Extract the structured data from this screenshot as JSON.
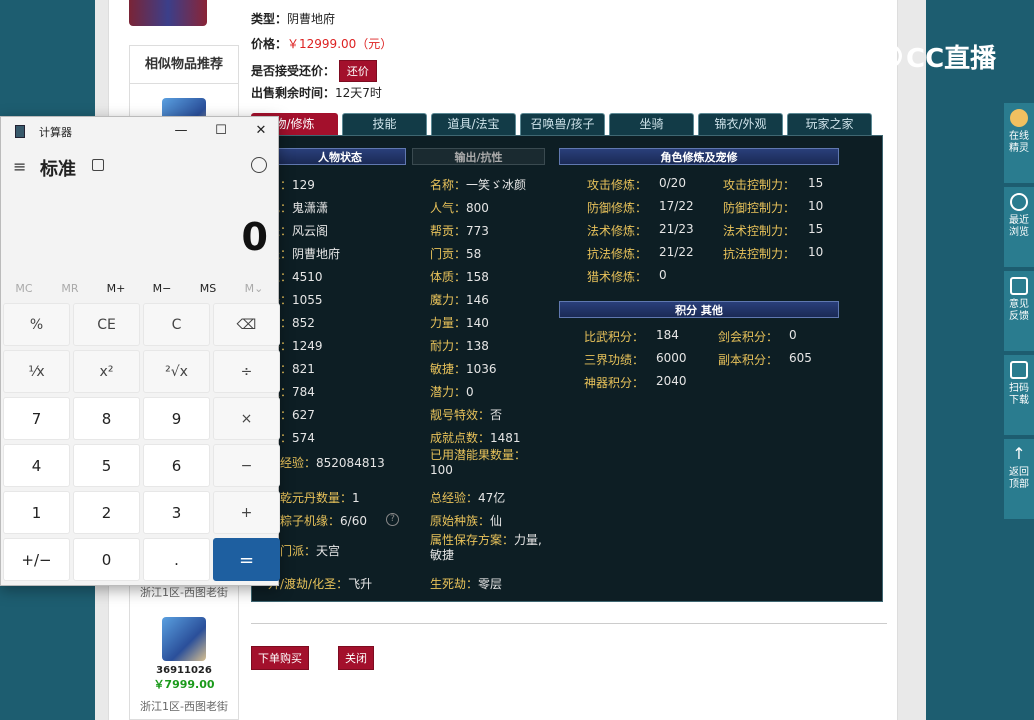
{
  "listing": {
    "type_label": "类型：",
    "type_value": "阴曹地府",
    "price_label": "价格：",
    "price_value": "￥12999.00（元）",
    "counter_offer_label": "是否接受还价：",
    "counter_offer_button": "还价",
    "remaining_label": "出售剩余时间：",
    "remaining_value": "12天7时",
    "buy_button": "下单购买",
    "close_button": "关闭"
  },
  "similar": {
    "title": "相似物品推荐",
    "server_top": "浙江1区-西图老街",
    "item_id": "36911026",
    "item_price": "￥7999.00",
    "server_bottom": "浙江1区-西图老街"
  },
  "tabs": [
    "物/修炼",
    "技能",
    "道具/法宝",
    "召唤兽/孩子",
    "坐骑",
    "锦衣/外观",
    "玩家之家"
  ],
  "panel": {
    "hdr_status": "人物状态",
    "hdr_output": "输出/抗性",
    "hdr_cultivation": "角色修炼及宠修",
    "hdr_points": "积分 其他",
    "col1": [
      {
        "k": "别：",
        "v": "129"
      },
      {
        "k": "色：",
        "v": "鬼潇潇"
      },
      {
        "k": "派：",
        "v": "风云阁"
      },
      {
        "k": "派：",
        "v": "阴曹地府"
      },
      {
        "k": "血：",
        "v": "4510"
      },
      {
        "k": "法：",
        "v": "1055"
      },
      {
        "k": "中：",
        "v": "852"
      },
      {
        "k": "害：",
        "v": "1249"
      },
      {
        "k": "御：",
        "v": "821"
      },
      {
        "k": "度：",
        "v": "784"
      },
      {
        "k": "伤：",
        "v": "627"
      },
      {
        "k": "防：",
        "v": "574"
      },
      {
        "k": "得经验：",
        "v": "852084813"
      },
      {
        "k": "版乾元丹数量：",
        "v": "1"
      },
      {
        "k": "饼粽子机缘：",
        "v": "6/60"
      },
      {
        "k": "史门派：",
        "v": "天宫"
      },
      {
        "k": "升/渡劫/化圣：",
        "v": "飞升"
      }
    ],
    "col2": [
      {
        "k": "名称：",
        "v": "一笑ゞ冰颜"
      },
      {
        "k": "人气：",
        "v": "800"
      },
      {
        "k": "帮贡：",
        "v": "773"
      },
      {
        "k": "门贡：",
        "v": "58"
      },
      {
        "k": "体质：",
        "v": "158"
      },
      {
        "k": "魔力：",
        "v": "146"
      },
      {
        "k": "力量：",
        "v": "140"
      },
      {
        "k": "耐力：",
        "v": "138"
      },
      {
        "k": "敏捷：",
        "v": "1036"
      },
      {
        "k": "潜力：",
        "v": "0"
      },
      {
        "k": "靓号特效：",
        "v": "否"
      },
      {
        "k": "成就点数：",
        "v": "1481"
      },
      {
        "k": "已用潜能果数量：",
        "v": "100"
      },
      {
        "k": "总经验：",
        "v": "47亿"
      },
      {
        "k": "原始种族：",
        "v": "仙"
      },
      {
        "k": "属性保存方案：",
        "v": "力量,敏捷"
      },
      {
        "k": "生死劫：",
        "v": "零层"
      }
    ],
    "cultivation": [
      {
        "k": "攻击修炼：",
        "v": "0/20",
        "k2": "攻击控制力：",
        "v2": "15"
      },
      {
        "k": "防御修炼：",
        "v": "17/22",
        "k2": "防御控制力：",
        "v2": "10"
      },
      {
        "k": "法术修炼：",
        "v": "21/23",
        "k2": "法术控制力：",
        "v2": "15"
      },
      {
        "k": "抗法修炼：",
        "v": "21/22",
        "k2": "抗法控制力：",
        "v2": "10"
      },
      {
        "k": "猎术修炼：",
        "v": "0",
        "k2": "",
        "v2": ""
      }
    ],
    "points": [
      {
        "k": "比武积分：",
        "v": "184",
        "k2": "剑会积分：",
        "v2": "0"
      },
      {
        "k": "三界功绩：",
        "v": "6000",
        "k2": "副本积分：",
        "v2": "605"
      },
      {
        "k": "神器积分：",
        "v": "2040",
        "k2": "",
        "v2": ""
      }
    ]
  },
  "overlay": {
    "brand": "CC直播"
  },
  "sidebar": [
    {
      "label": "在线\n精灵",
      "icon": "sprite-icon"
    },
    {
      "label": "最近\n浏览",
      "icon": "clock-icon"
    },
    {
      "label": "意见\n反馈",
      "icon": "edit-icon"
    },
    {
      "label": "扫码\n下载",
      "icon": "scan-icon"
    },
    {
      "label": "返回\n顶部",
      "icon": "arrow-up-icon"
    }
  ],
  "calculator": {
    "title": "计算器",
    "mode": "标准",
    "display": "0",
    "memory": [
      "MC",
      "MR",
      "M+",
      "M−",
      "MS",
      "M⌄"
    ],
    "keys": [
      [
        "%",
        "CE",
        "C",
        "⌫"
      ],
      [
        "¹⁄x",
        "x²",
        "²√x",
        "÷"
      ],
      [
        "7",
        "8",
        "9",
        "×"
      ],
      [
        "4",
        "5",
        "6",
        "−"
      ],
      [
        "1",
        "2",
        "3",
        "+"
      ],
      [
        "+/−",
        "0",
        ".",
        "="
      ]
    ]
  }
}
